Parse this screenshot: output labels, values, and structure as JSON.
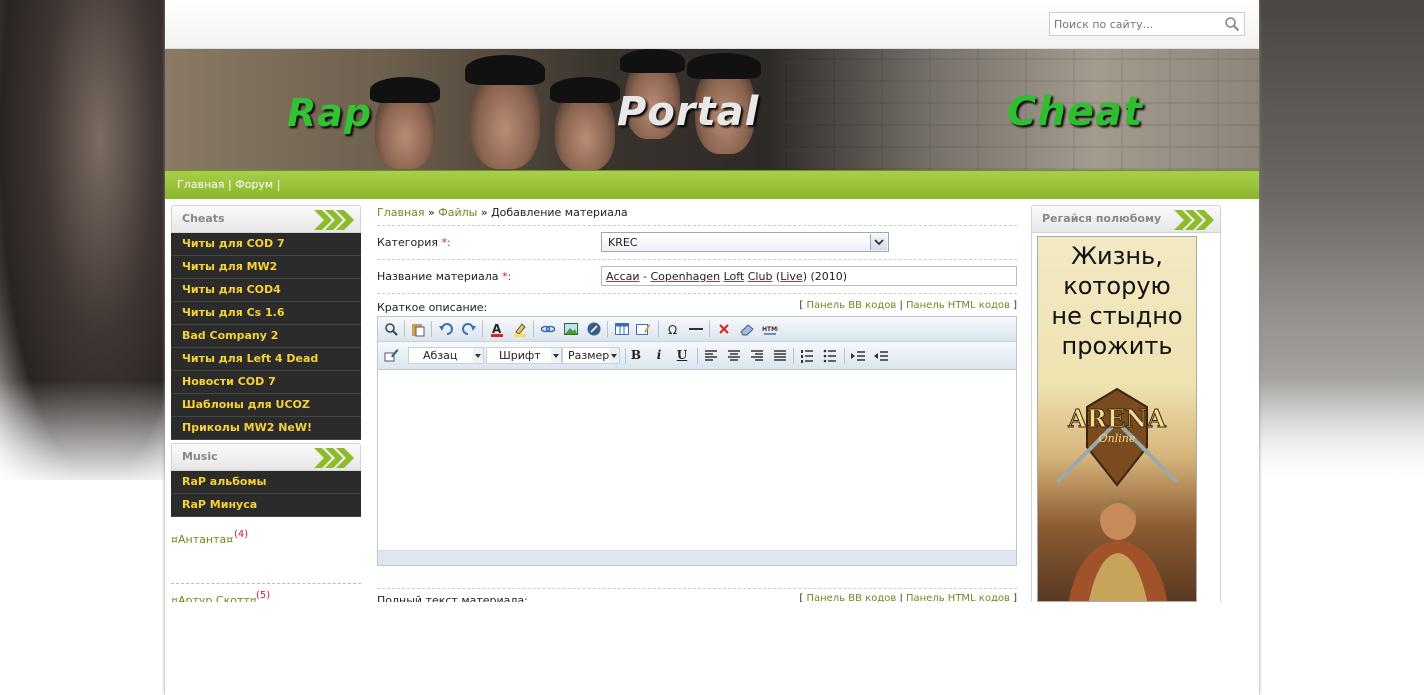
{
  "search": {
    "placeholder": "Поиск по сайту..."
  },
  "banner": {
    "logo_rap": "Rap",
    "logo_portal": "Portal",
    "logo_cheat": "Cheat"
  },
  "nav": {
    "items": [
      "Главная",
      "Форум"
    ],
    "separator": "|"
  },
  "left_sidebar": {
    "cheats_title": "Cheats",
    "cheats": [
      "Читы для COD 7",
      "Читы для MW2",
      "Читы для COD4",
      "Читы для Cs 1.6",
      "Bad Company 2",
      "Читы для Left 4 Dead",
      "Новости COD 7",
      "Шаблоны для UCOZ",
      "Приколы MW2 NeW!"
    ],
    "music_title": "Music",
    "music": [
      "RaP альбомы",
      "RaP Минуса"
    ],
    "comments": [
      {
        "name": "Антанта",
        "count": "(4)"
      },
      {
        "name": "Артур Скотт",
        "count": "(5)"
      }
    ]
  },
  "main": {
    "breadcrumb": {
      "home": "Главная",
      "sep": "»",
      "files": "Файлы",
      "current": "Добавление материала"
    },
    "category_label": "Категория",
    "category_value": "KREC",
    "required_mark": "*:",
    "title_label": "Название материала",
    "title_parts": [
      "Ассаи",
      " - ",
      "Copenhagen",
      " ",
      "Loft",
      " ",
      "Club",
      " (",
      "Live",
      ") (2010)"
    ],
    "short_label": "Краткое описание:",
    "full_label": "Полный текст материала:",
    "panel_bb": "Панель BB кодов",
    "panel_html": "Панель HTML кодов",
    "editor": {
      "paragraph": "Абзац",
      "font": "Шрифт",
      "size": "Размер",
      "bold": "B",
      "italic": "i",
      "underline": "U"
    }
  },
  "right_sidebar": {
    "title": "Регайся полюбому",
    "ad_lines": [
      "Жизнь,",
      "которую",
      "не стыдно",
      "прожить"
    ],
    "ad_logo": "ARENA",
    "ad_logo_sub": "Online"
  }
}
